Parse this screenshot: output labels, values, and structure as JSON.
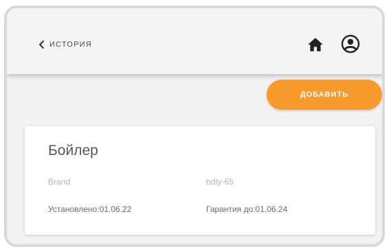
{
  "header": {
    "back_label": "ИСТОРИЯ"
  },
  "icons": {
    "back": "chevron-left-icon",
    "home": "home-icon",
    "user": "user-circle-icon"
  },
  "actions": {
    "add_label": "ДОБАВИТЬ"
  },
  "colors": {
    "accent": "#f89a2c",
    "header_bg": "#f4f4f4",
    "page_bg": "#f2f2f2",
    "icon": "#222222"
  },
  "device": {
    "title": "Бойлер",
    "brand": "Brand",
    "model": "bdty-65",
    "installed_label": "Установлено:",
    "installed_date": "01.06.22",
    "warranty_label": "Гарантия до:",
    "warranty_date": "01.06.24"
  }
}
